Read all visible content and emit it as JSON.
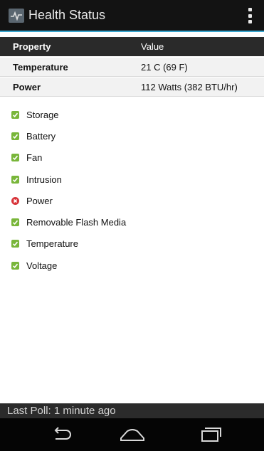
{
  "app": {
    "title": "Health Status"
  },
  "table": {
    "headers": {
      "property": "Property",
      "value": "Value"
    },
    "rows": [
      {
        "property": "Temperature",
        "value": "21 C (69 F)"
      },
      {
        "property": "Power",
        "value": "112 Watts (382 BTU/hr)"
      }
    ]
  },
  "components": [
    {
      "label": "Storage",
      "status": "ok"
    },
    {
      "label": "Battery",
      "status": "ok"
    },
    {
      "label": "Fan",
      "status": "ok"
    },
    {
      "label": "Intrusion",
      "status": "ok"
    },
    {
      "label": "Power",
      "status": "error"
    },
    {
      "label": "Removable Flash Media",
      "status": "ok"
    },
    {
      "label": "Temperature",
      "status": "ok"
    },
    {
      "label": "Voltage",
      "status": "ok"
    }
  ],
  "footer": {
    "last_poll": "Last Poll: 1 minute ago"
  },
  "icons": {
    "app": "health-monitor-icon",
    "overflow": "overflow-menu-icon",
    "ok": "check-icon",
    "error": "x-circle-icon",
    "back": "back-icon",
    "home": "home-icon",
    "recents": "recent-apps-icon"
  },
  "colors": {
    "accent": "#38a6cf",
    "ok": "#79b63a",
    "error": "#d8343a"
  }
}
